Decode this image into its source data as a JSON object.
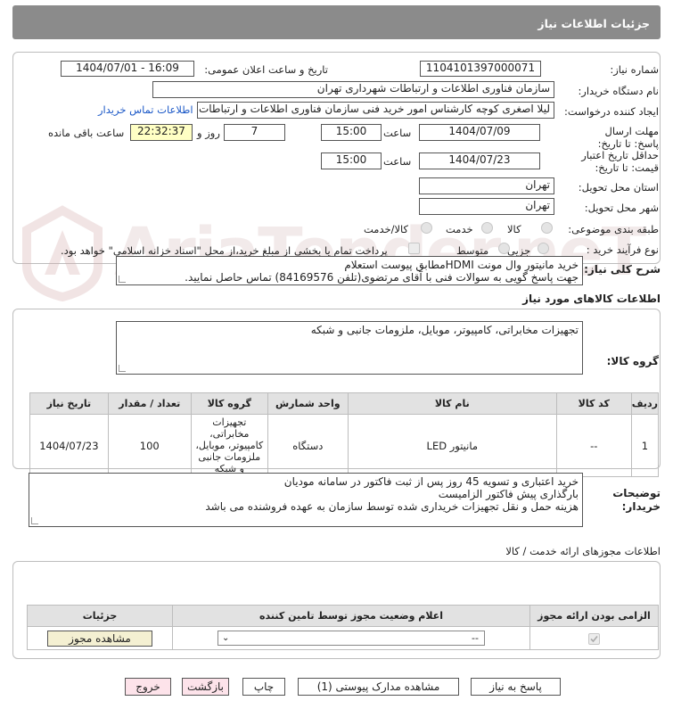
{
  "header": {
    "title": "جزئیات اطلاعات نیاز"
  },
  "form": {
    "need_number_label": "شماره نیاز:",
    "need_number": "1104101397000071",
    "announce_label": "تاریخ و ساعت اعلان عمومی:",
    "announce_value": "1404/07/01 - 16:09",
    "buyer_org_label": "نام دستگاه خریدار:",
    "buyer_org": "سازمان فناوری اطلاعات و ارتباطات شهرداری تهران",
    "creator_label": "ایجاد کننده درخواست:",
    "creator": "لیلا اصغری کوچه کارشناس امور خرید فنی سازمان فناوری اطلاعات و ارتباطات ش",
    "contact_link": "اطلاعات تماس خریدار",
    "deadline_label": "مهلت ارسال پاسخ: تا تاریخ:",
    "deadline_date": "1404/07/09",
    "time_label": "ساعت",
    "deadline_time": "15:00",
    "days_value": "7",
    "days_label": "روز و",
    "remaining_time": "22:32:37",
    "remaining_label": "ساعت باقی مانده",
    "validity_label": "حداقل تاریخ اعتبار قیمت: تا تاریخ:",
    "validity_date": "1404/07/23",
    "validity_time": "15:00",
    "province_label": "استان محل تحویل:",
    "province": "تهران",
    "city_label": "شهر محل تحویل:",
    "city": "تهران",
    "category_label": "طبقه بندی موضوعی:",
    "cat_goods": "کالا",
    "cat_service": "خدمت",
    "cat_both": "کالا/خدمت",
    "process_label": "نوع فرآیند خرید :",
    "proc_partial": "جزیی",
    "proc_medium": "متوسط",
    "payment_note": "پرداخت تمام یا بخشی از مبلغ خرید،از محل \"اسناد خزانه اسلامی\" خواهد بود."
  },
  "desc": {
    "label": "شرح کلی نیاز:",
    "line1": "خرید  مانیتور وال مونت HDMIمطابق پیوست استعلام",
    "line2": "جهت پاسخ گویی به سوالات فنی با آقای مرتضوی(تلفن 84169576) تماس حاصل نمایید."
  },
  "goods": {
    "section_title": "اطلاعات کالاهای مورد نیاز",
    "group_label": "گروه کالا:",
    "group_value": "تجهیزات مخابراتی، کامپیوتر، موبایل، ملزومات جانبی و شبکه",
    "headers": [
      "ردیف",
      "کد کالا",
      "نام کالا",
      "واحد شمارش",
      "گروه کالا",
      "تعداد / مقدار",
      "تاریخ نیاز"
    ],
    "row": {
      "index": "1",
      "code": "--",
      "name": "مانیتور LED",
      "unit": "دستگاه",
      "group": "تجهیزات مخابراتی، کامپیوتر، موبایل، ملزومات جانبی و شبکه",
      "qty": "100",
      "date": "1404/07/23"
    }
  },
  "buyer_notes": {
    "label": "توضیحات خریدار:",
    "line1": "خرید اعتباری و تسویه 45 روز پس از ثبت فاکتور در سامانه مودیان",
    "line2": "بارگذاری پیش فاکتور الزامیست",
    "line3": "هزینه حمل و نقل تجهیزات خریداری شده توسط سازمان به عهده فروشنده می باشد"
  },
  "permits": {
    "section_title": "اطلاعات مجوزهای ارائه خدمت / کالا",
    "headers": [
      "الزامی بودن ارائه مجوز",
      "اعلام وضعیت مجوز توسط تامین کننده",
      "جزئیات"
    ],
    "select_value": "--",
    "view_button": "مشاهده مجوز"
  },
  "actions": {
    "reply": "پاسخ به نیاز",
    "attachments": "مشاهده مدارک پیوستی (1)",
    "print": "چاپ",
    "back": "بازگشت",
    "exit": "خروج"
  },
  "colors": {
    "titlebar": "#8b8b8b",
    "link": "#1b58c7",
    "highlight": "#ffffc4",
    "pink_button": "#fde3ea"
  }
}
